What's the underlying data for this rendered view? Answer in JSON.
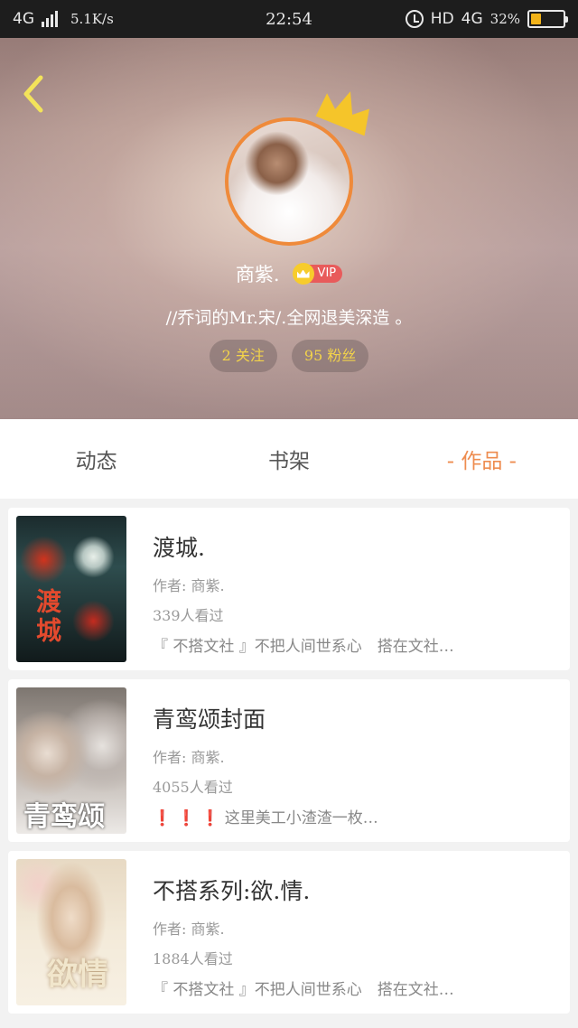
{
  "status_bar": {
    "network": "4G",
    "speed": "5.1K/s",
    "time": "22:54",
    "hd": "HD",
    "net_right": "4G",
    "battery_pct": "32%",
    "battery_level": 0.32,
    "battery_color": "#f2b31a"
  },
  "profile": {
    "nickname": "商紫.",
    "vip_label": "VIP",
    "signature": "//乔词的Mr.宋/.全网退美深造 。",
    "following": "2 关注",
    "followers": "95 粉丝",
    "accent_color": "#ef8a3a"
  },
  "tabs": [
    {
      "label": "动态"
    },
    {
      "label": "书架"
    },
    {
      "label": "- 作品 -"
    }
  ],
  "works": [
    {
      "title": "渡城.",
      "author": "作者: 商紫.",
      "views": "339人看过",
      "desc": "『 不搭文社 』不把人间世系心　搭在文社…",
      "cover_text": "渡城"
    },
    {
      "title": "青鸾颂封面",
      "author": "作者: 商紫.",
      "views": "4055人看过",
      "desc": "❗ ❗ ❗ 这里美工小渣渣一枚…",
      "cover_text": "青鸾颂"
    },
    {
      "title": "不搭系列:欲.情.",
      "author": "作者: 商紫.",
      "views": "1884人看过",
      "desc": "『 不搭文社 』不把人间世系心　搭在文社…",
      "cover_text": "欲情"
    }
  ]
}
